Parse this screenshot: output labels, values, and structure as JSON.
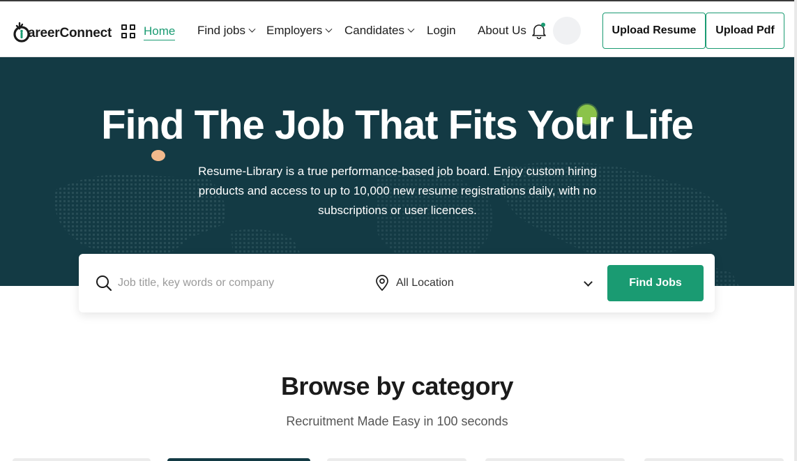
{
  "header": {
    "logo_text": "areerConnect",
    "logo_letter": "C",
    "nav": [
      {
        "label": "Home",
        "active": true
      },
      {
        "label": "Find jobs",
        "dropdown": true
      },
      {
        "label": "Employers",
        "dropdown": true
      },
      {
        "label": "Candidates",
        "dropdown": true
      },
      {
        "label": "Login"
      },
      {
        "label": "About Us"
      }
    ],
    "upload_resume_label": "Upload Resume",
    "upload_pdf_label": "Upload Pdf"
  },
  "hero": {
    "title": "Find The Job That Fits Your Life",
    "description": "Resume-Library is a true performance-based job board. Enjoy custom hiring products and access to up to 10,000 new resume registrations daily, with no subscriptions or user licences."
  },
  "search": {
    "placeholder": "Job title, key words or company",
    "location_value": "All Location",
    "find_label": "Find Jobs"
  },
  "browse": {
    "title": "Browse by category",
    "subtitle": "Recruitment Made Easy in 100 seconds"
  },
  "colors": {
    "accent": "#1a9b72",
    "hero_bg": "#133a44",
    "blob_green": "#8bc34a",
    "blob_orange": "#f2b98c"
  },
  "icons": [
    "grid-icon",
    "chevron-down-icon",
    "bell-icon",
    "search-icon",
    "location-pin-icon",
    "logo-icon"
  ]
}
